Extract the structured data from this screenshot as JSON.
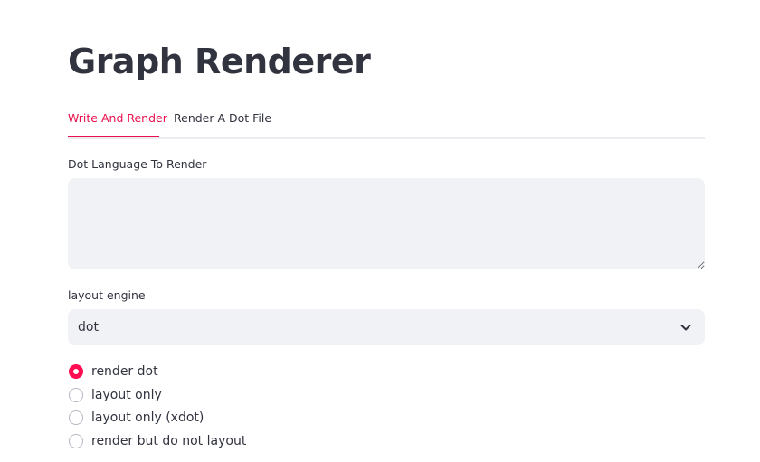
{
  "header": {
    "title": "Graph Renderer"
  },
  "tabs": [
    {
      "label": "Write And Render",
      "active": true
    },
    {
      "label": "Render A Dot File",
      "active": false
    }
  ],
  "dot_input": {
    "label": "Dot Language To Render",
    "value": "",
    "placeholder": ""
  },
  "layout_engine": {
    "label": "layout engine",
    "selected": "dot",
    "icon": "chevron-down-icon"
  },
  "render_mode": {
    "options": [
      {
        "label": "render dot",
        "checked": true
      },
      {
        "label": "layout only",
        "checked": false
      },
      {
        "label": "layout only (xdot)",
        "checked": false
      },
      {
        "label": "render but do not layout",
        "checked": false
      }
    ]
  },
  "colors": {
    "accent": "#ff2b5e",
    "tab_active": "#e8114d",
    "input_bg": "#f0f2f6",
    "text": "#31333f"
  }
}
